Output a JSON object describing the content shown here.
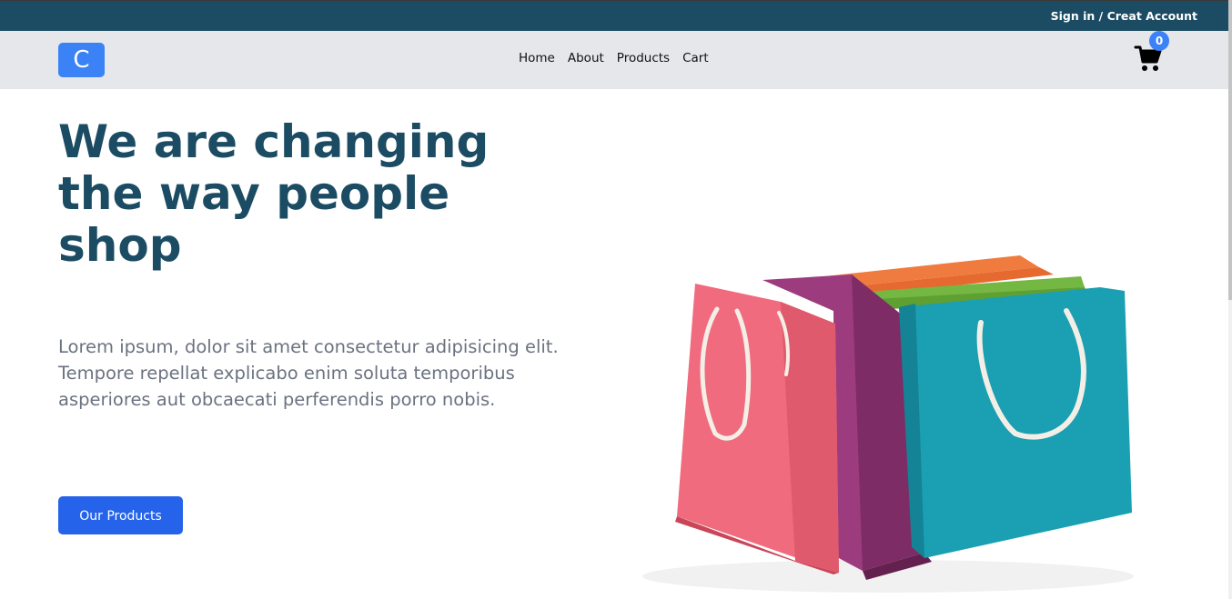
{
  "topbar": {
    "auth_link": "Sign in / Creat Account",
    "background": "#1b4c63"
  },
  "navbar": {
    "logo_letter": "C",
    "links": [
      "Home",
      "About",
      "Products",
      "Cart"
    ],
    "cart_icon": "shopping-cart-icon",
    "cart_count": "0",
    "accent": "#3b82f6"
  },
  "hero": {
    "title": "We are changing the way people shop",
    "text": "Lorem ipsum, dolor sit amet consectetur adipisicing elit. Tempore repellat explicabo enim soluta temporibus asperiores aut obcaecati perferendis porro nobis.",
    "cta_label": "Our Products",
    "title_color": "#1b4c63",
    "cta_color": "#2563eb",
    "image": "shopping-bags-image"
  }
}
